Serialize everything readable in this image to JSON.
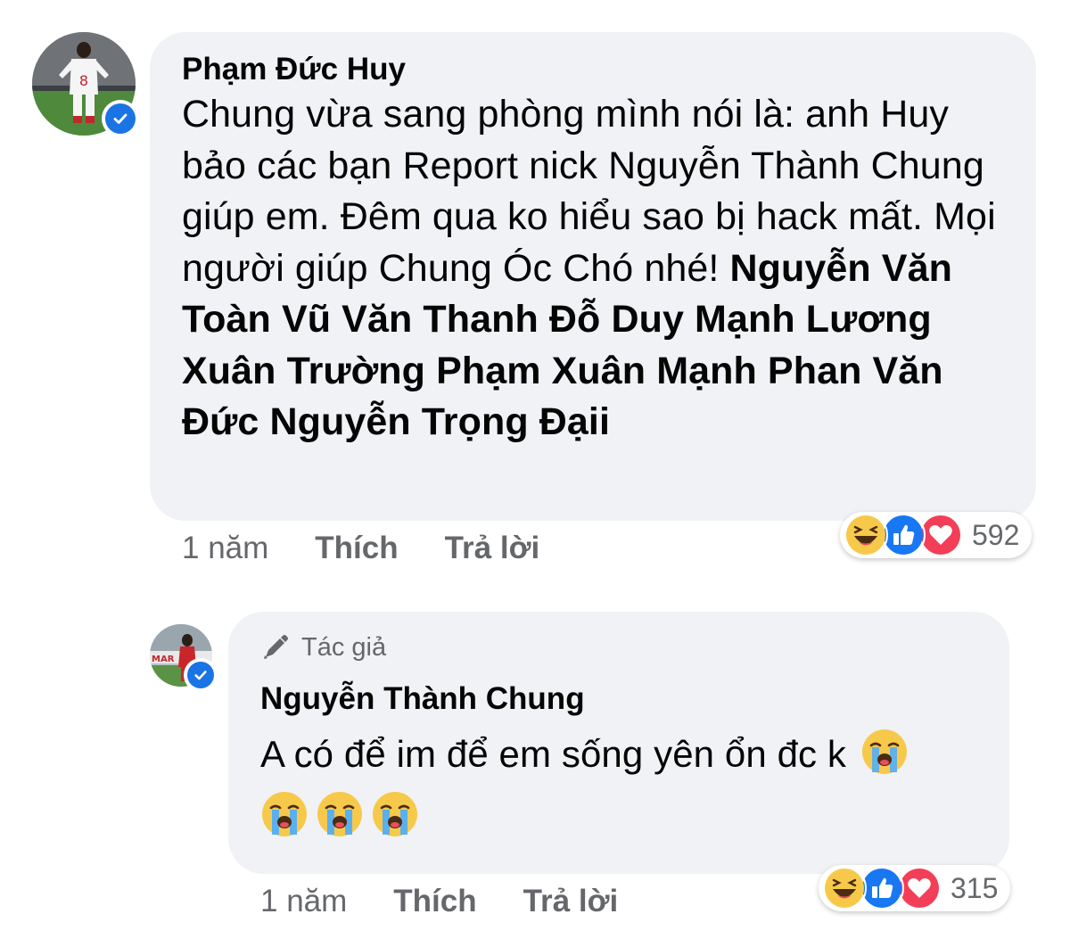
{
  "comment1": {
    "author": "Phạm Đức Huy",
    "verified": true,
    "avatar_icon": "player-avatar",
    "text": "Chung vừa sang phòng mình nói là: anh Huy bảo các bạn Report nick Nguyễn Thành Chung giúp em. Đêm qua ko hiểu sao bị hack mất. Mọi người giúp Chung Óc Chó nhé!",
    "tags": "Nguyễn Văn Toàn Vũ Văn Thanh Đỗ Duy Mạnh Lương Xuân Trường Phạm Xuân Mạnh Phan Văn Đức Nguyễn Trọng Đạii",
    "time": "1 năm",
    "like_label": "Thích",
    "reply_label": "Trả lời",
    "reactions": [
      "haha",
      "like",
      "love"
    ],
    "reaction_count": "592"
  },
  "comment2": {
    "author_tag": "Tác giả",
    "author_tag_icon": "pen-icon",
    "author": "Nguyễn Thành Chung",
    "verified": true,
    "avatar_icon": "player-avatar",
    "text": "A có để im để em sống yên ổn đc k",
    "emoji_icon": "loudly-crying-face",
    "trailing_emoji_count": 3,
    "time": "1 năm",
    "like_label": "Thích",
    "reply_label": "Trả lời",
    "reactions": [
      "haha",
      "like",
      "love"
    ],
    "reaction_count": "315"
  },
  "colors": {
    "bubble_bg": "#f0f2f5",
    "text": "#050505",
    "secondary_text": "#65676b",
    "verified_blue": "#1b74e4",
    "like_blue": "#1877f2",
    "love_red": "#f33e58",
    "haha_yellow": "#f7c94b"
  }
}
